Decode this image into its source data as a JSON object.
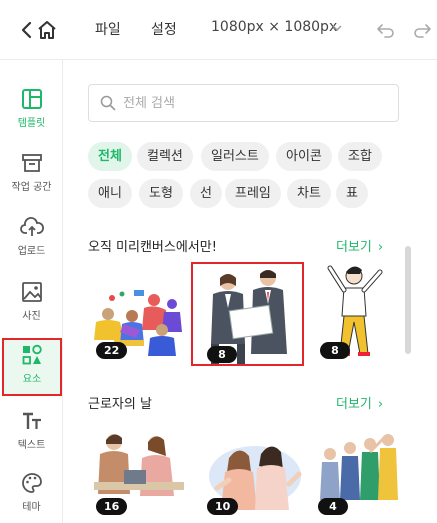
{
  "topbar": {
    "menu": [
      "파일",
      "설정"
    ],
    "canvas_size": "1080px × 1080px"
  },
  "sidebar": {
    "items": [
      {
        "label": "템플릿",
        "icon": "template-icon",
        "active": true
      },
      {
        "label": "작업 공간",
        "icon": "workspace-icon"
      },
      {
        "label": "업로드",
        "icon": "upload-cloud-icon"
      },
      {
        "label": "사진",
        "icon": "photo-icon"
      },
      {
        "label": "요소",
        "icon": "elements-icon"
      },
      {
        "label": "텍스트",
        "icon": "text-icon"
      },
      {
        "label": "테마",
        "icon": "palette-icon"
      }
    ]
  },
  "search": {
    "placeholder": "전체 검색",
    "value": ""
  },
  "chips": [
    "전체",
    "컬렉션",
    "일러스트",
    "아이콘",
    "조합",
    "애니",
    "도형",
    "선",
    "프레임",
    "차트",
    "표"
  ],
  "sections": [
    {
      "title": "오직 미리캔버스에서만!",
      "more": "더보기",
      "items": [
        {
          "count": "22",
          "name": "team-celebration-illustration"
        },
        {
          "count": "8",
          "name": "business-people-illustration"
        },
        {
          "count": "8",
          "name": "cheering-person-illustration"
        }
      ]
    },
    {
      "title": "근로자의 날",
      "more": "더보기",
      "items": [
        {
          "count": "16",
          "name": "office-workers-illustration"
        },
        {
          "count": "10",
          "name": "happy-women-illustration"
        },
        {
          "count": "4",
          "name": "group-workers-illustration"
        }
      ]
    }
  ],
  "colors": {
    "accent": "#1fb76a",
    "highlight": "#e2262a"
  }
}
